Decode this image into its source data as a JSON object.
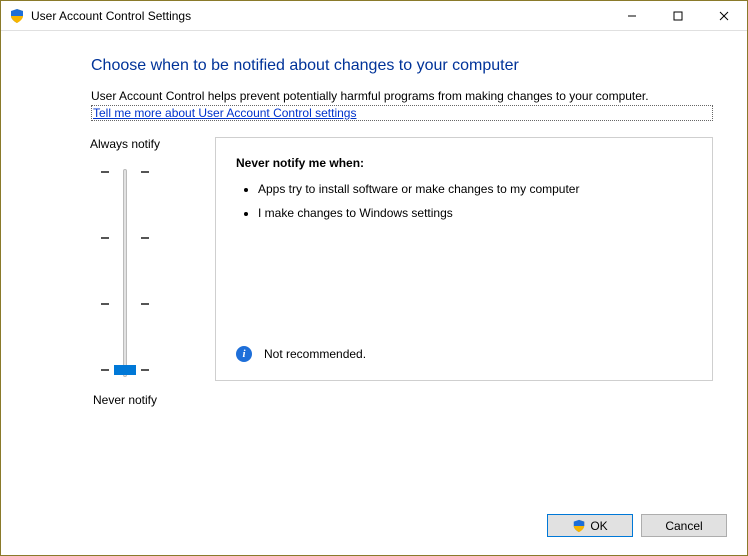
{
  "titlebar": {
    "text": "User Account Control Settings"
  },
  "heading": "Choose when to be notified about changes to your computer",
  "intro": "User Account Control helps prevent potentially harmful programs from making changes to your computer.",
  "link_text": "Tell me more about User Account Control settings",
  "slider": {
    "top_label": "Always notify",
    "bottom_label": "Never notify",
    "levels": 4,
    "current_level": 0
  },
  "description": {
    "title": "Never notify me when:",
    "bullets": [
      "Apps try to install software or make changes to my computer",
      "I make changes to Windows settings"
    ],
    "recommendation": "Not recommended."
  },
  "buttons": {
    "ok": "OK",
    "cancel": "Cancel"
  }
}
